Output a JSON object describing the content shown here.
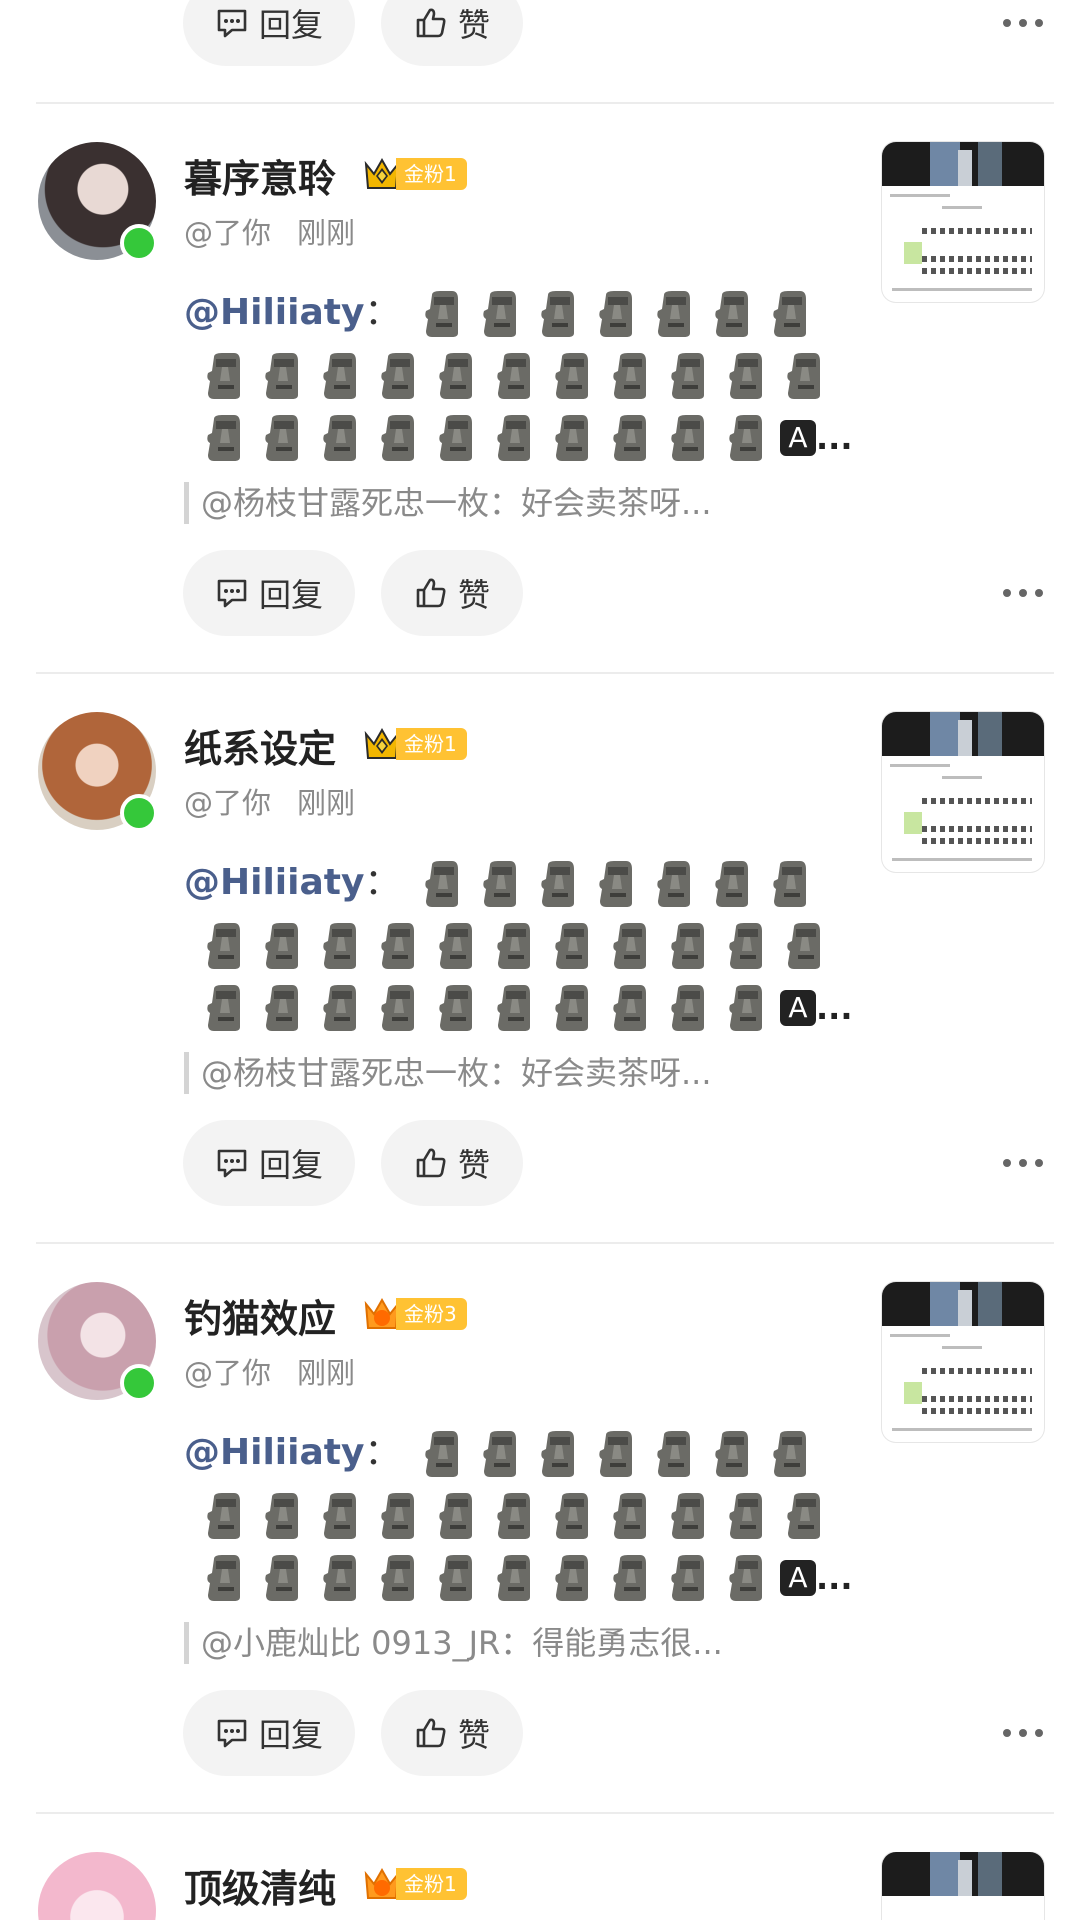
{
  "action_labels": {
    "reply": "回复",
    "like": "赞"
  },
  "comments": [
    {
      "name": "暮序意聆",
      "badge": "金粉1",
      "crown": "crown-icon",
      "meta_user": "@了你",
      "meta_time": "刚刚",
      "mention": "@Hiliiaty",
      "colon": "：",
      "ellipsis": "...",
      "box_letter": "A",
      "quote": "@杨枝甘露死忠一枚：好会卖茶呀..."
    },
    {
      "name": "纸系设定",
      "badge": "金粉1",
      "crown": "crown-icon",
      "meta_user": "@了你",
      "meta_time": "刚刚",
      "mention": "@Hiliiaty",
      "colon": "：",
      "ellipsis": "...",
      "box_letter": "A",
      "quote": "@杨枝甘露死忠一枚：好会卖茶呀..."
    },
    {
      "name": "钓猫效应",
      "badge": "金粉3",
      "crown": "crown-level-5-icon",
      "meta_user": "@了你",
      "meta_time": "刚刚",
      "mention": "@Hiliiaty",
      "colon": "：",
      "ellipsis": "...",
      "box_letter": "A",
      "quote": "@小鹿灿比 0913_JR：得能勇志很..."
    },
    {
      "name": "顶级清纯",
      "badge": "金粉1",
      "crown": "crown-level-6-icon"
    }
  ],
  "colors": {
    "mention": "#4a5f8c",
    "online": "#35c83a",
    "badge": "#ffc233"
  }
}
